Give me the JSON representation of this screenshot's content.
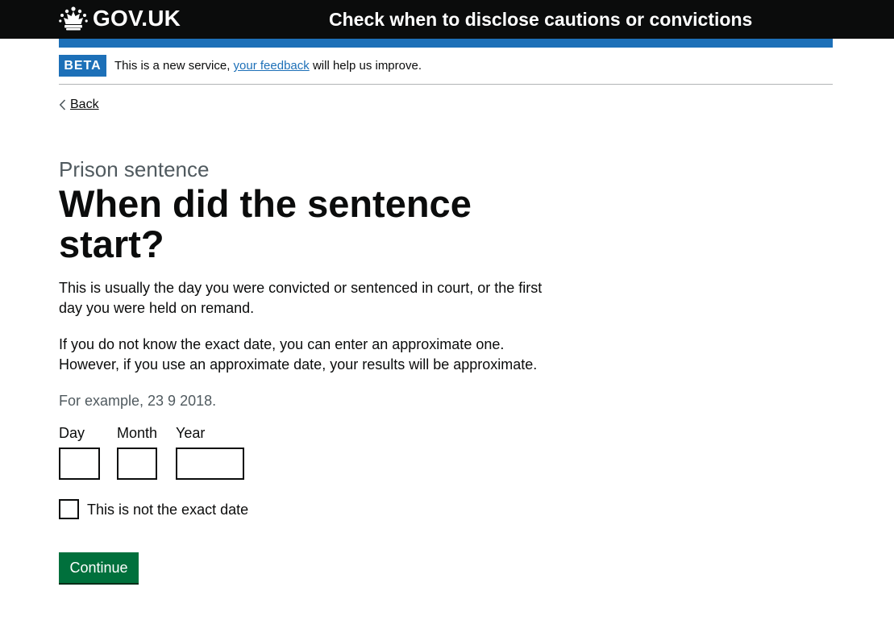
{
  "header": {
    "logo_text": "GOV.UK",
    "logo_icon": "crown-icon",
    "service_name": "Check when to disclose cautions or convictions"
  },
  "phase_banner": {
    "tag": "BETA",
    "text_before": "This is a new service, ",
    "link_text": "your feedback",
    "text_after": " will help us improve."
  },
  "back_link": {
    "icon": "chevron-left-icon",
    "label": "Back"
  },
  "main": {
    "caption": "Prison sentence",
    "title": "When did the sentence start?",
    "paragraphs": [
      "This is usually the day you were convicted or sentenced in court, or the first day you were held on remand.",
      "If you do not know the exact date, you can enter an approximate one. However, if you use an approximate date, your results will be approximate."
    ],
    "hint": "For example, 23 9 2018.",
    "date_fields": {
      "day": {
        "label": "Day",
        "value": ""
      },
      "month": {
        "label": "Month",
        "value": ""
      },
      "year": {
        "label": "Year",
        "value": ""
      }
    },
    "checkbox": {
      "label": "This is not the exact date",
      "checked": false
    },
    "continue_label": "Continue"
  },
  "colors": {
    "header_bg": "#0b0c0c",
    "brand_blue": "#1d70b8",
    "button_green": "#00703c",
    "secondary_text": "#505a5f",
    "border_grey": "#b1b4b6"
  }
}
